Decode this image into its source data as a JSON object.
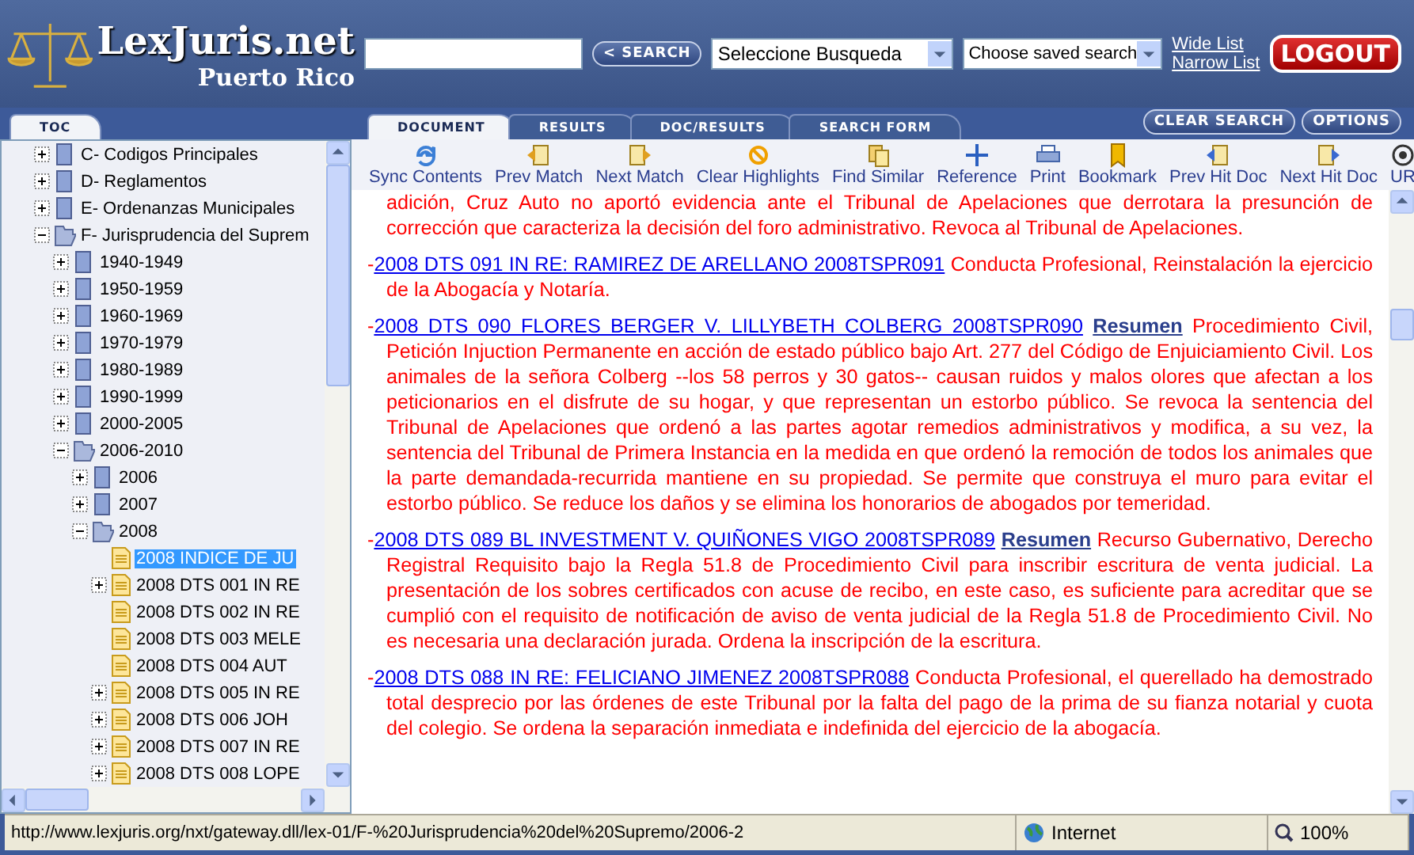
{
  "header": {
    "logo_title": "LexJuris.net",
    "logo_subtitle": "Puerto Rico",
    "search_button": "< SEARCH",
    "search_select": "Seleccione Busqueda",
    "saved_select": "Choose saved search",
    "links": [
      "Wide List",
      "Narrow List"
    ],
    "logout": "LOGOUT"
  },
  "left_tabs": [
    {
      "label": "TOC",
      "selected": true
    }
  ],
  "tabs": [
    {
      "label": "DOCUMENT",
      "selected": true
    },
    {
      "label": "RESULTS",
      "selected": false
    },
    {
      "label": "DOC/RESULTS",
      "selected": false
    },
    {
      "label": "SEARCH FORM",
      "selected": false
    }
  ],
  "right_buttons": [
    "CLEAR SEARCH",
    "OPTIONS"
  ],
  "tree": [
    {
      "label": "C- Codigos Principales",
      "kind": "book",
      "expanded": false,
      "selected": false
    },
    {
      "label": "D- Reglamentos",
      "kind": "book",
      "expanded": false,
      "selected": false
    },
    {
      "label": "E- Ordenanzas Municipales",
      "kind": "book",
      "expanded": false,
      "selected": false
    },
    {
      "label": "F- Jurisprudencia del Suprem",
      "kind": "book",
      "expanded": true,
      "selected": false,
      "children": [
        {
          "label": "1940-1949",
          "kind": "book",
          "expanded": false,
          "selected": false
        },
        {
          "label": "1950-1959",
          "kind": "book",
          "expanded": false,
          "selected": false
        },
        {
          "label": "1960-1969",
          "kind": "book",
          "expanded": false,
          "selected": false
        },
        {
          "label": "1970-1979",
          "kind": "book",
          "expanded": false,
          "selected": false
        },
        {
          "label": "1980-1989",
          "kind": "book",
          "expanded": false,
          "selected": false
        },
        {
          "label": "1990-1999",
          "kind": "book",
          "expanded": false,
          "selected": false
        },
        {
          "label": "2000-2005",
          "kind": "book",
          "expanded": false,
          "selected": false
        },
        {
          "label": "2006-2010",
          "kind": "book",
          "expanded": true,
          "selected": false,
          "children": [
            {
              "label": "2006",
              "kind": "book",
              "expanded": false,
              "selected": false
            },
            {
              "label": "2007",
              "kind": "book",
              "expanded": false,
              "selected": false
            },
            {
              "label": "2008",
              "kind": "book",
              "expanded": true,
              "selected": false,
              "children": [
                {
                  "label": "2008 INDICE DE JU",
                  "kind": "document",
                  "selected": true
                },
                {
                  "label": "2008 DTS 001 IN RE",
                  "kind": "document",
                  "expanded": false,
                  "selected": false
                },
                {
                  "label": "2008 DTS 002 IN RE",
                  "kind": "document",
                  "selected": false
                },
                {
                  "label": "2008 DTS 003 MELE",
                  "kind": "document",
                  "selected": false
                },
                {
                  "label": "2008 DTS 004 AUT",
                  "kind": "document",
                  "selected": false
                },
                {
                  "label": "2008 DTS 005 IN RE",
                  "kind": "document",
                  "expanded": false,
                  "selected": false
                },
                {
                  "label": "2008 DTS 006 JOH",
                  "kind": "document",
                  "expanded": false,
                  "selected": false
                },
                {
                  "label": "2008 DTS 007 IN RE",
                  "kind": "document",
                  "expanded": false,
                  "selected": false
                },
                {
                  "label": "2008 DTS 008 LOPE",
                  "kind": "document",
                  "expanded": false,
                  "selected": false
                }
              ]
            }
          ]
        }
      ]
    }
  ],
  "toolbar": [
    {
      "label": "Sync Contents",
      "kind": "sync"
    },
    {
      "label": "Prev Match",
      "kind": "prev"
    },
    {
      "label": "Next Match",
      "kind": "next"
    },
    {
      "label": "Clear Highlights",
      "kind": "clear"
    },
    {
      "label": "Find Similar",
      "kind": "similar"
    },
    {
      "label": "Reference",
      "kind": "reference"
    },
    {
      "label": "Print",
      "kind": "print"
    },
    {
      "label": "Bookmark",
      "kind": "bookmark"
    },
    {
      "label": "Prev Hit Doc",
      "kind": "prevdoc"
    },
    {
      "label": "Next Hit Doc",
      "kind": "nextdoc"
    },
    {
      "label": "UR",
      "kind": "radio"
    }
  ],
  "entries": [
    {
      "text": "adición, Cruz Auto no aportó evidencia ante el Tribunal de Apelaciones que derrotara la presunción de corrección que caracteriza la decisión del foro administrativo. Revoca al Tribunal de Apelaciones."
    },
    {
      "dash": "-",
      "link": "2008 DTS 091 IN RE: RAMIREZ DE ARELLANO 2008TSPR091",
      "text": "Conducta Profesional, Reinstalación la ejercicio de la Abogacía y Notaría."
    },
    {
      "dash": "-",
      "link": "2008 DTS 090 FLORES BERGER V. LILLYBETH COLBERG 2008TSPR090",
      "resumen": "Resumen",
      "text": "Procedimiento Civil, Petición Injuction Permanente en acción de estado público bajo Art. 277 del Código de Enjuiciamiento Civil. Los animales de la señora Colberg --los 58 perros y 30 gatos-- causan ruidos y malos olores que afectan a los peticionarios en el disfrute de su hogar, y que representan un estorbo público. Se revoca la sentencia del Tribunal de Apelaciones que ordenó a las partes agotar remedios administrativos y modifica, a su vez, la sentencia del Tribunal de Primera Instancia en la medida en que ordenó la remoción de todos los animales que la parte demandada-recurrida mantiene en su propiedad. Se permite que construya el muro para evitar el estorbo público. Se reduce los daños y se elimina los honorarios de abogados por temeridad."
    },
    {
      "dash": "-",
      "link": "2008 DTS 089 BL INVESTMENT V. QUIÑONES VIGO 2008TSPR089",
      "resumen": "Resumen",
      "text": "Recurso Gubernativo, Derecho Registral Requisito bajo la Regla 51.8 de Procedimiento Civil para inscribir escritura de venta judicial. La presentación de los sobres certificados con acuse de recibo, en este caso, es suficiente para acreditar que se cumplió con el requisito de notificación de aviso de venta judicial de la Regla 51.8 de Procedimiento Civil. No es necesaria una declaración jurada. Ordena la inscripción de la escritura."
    },
    {
      "dash": "-",
      "link": "2008 DTS 088 IN RE: FELICIANO JIMENEZ 2008TSPR088",
      "text": "Conducta Profesional, el querellado ha demostrado total desprecio por las órdenes de este Tribunal por la falta del pago de la prima de su fianza notarial y cuota del colegio. Se ordena la separación inmediata e indefinida del ejercicio de la abogacía."
    }
  ],
  "status_bar": {
    "url": "http://www.lexjuris.org/nxt/gateway.dll/lex-01/F-%20Jurisprudencia%20del%20Supremo/2006-2",
    "zone": "Internet",
    "zoom": "100%"
  }
}
